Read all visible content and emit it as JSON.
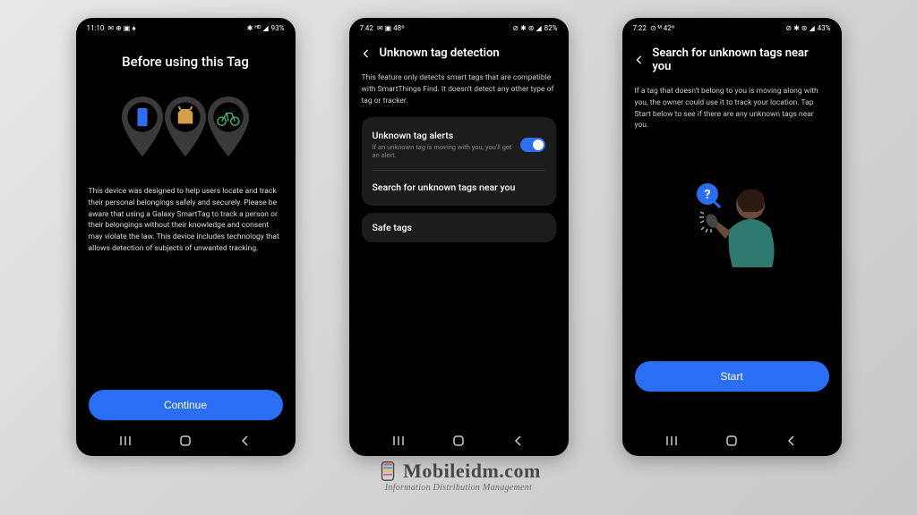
{
  "phones": [
    {
      "status": {
        "time": "11:10",
        "icons_left": "✉ ⊕ ▣ ♠",
        "icons_right": "✱ ᴴᴰ ◢",
        "battery": "93%"
      },
      "title": "Before using this Tag",
      "body": "This device was designed to help users locate and track their personal belongings safely and securely. Please be aware that using a Galaxy SmartTag to track a person or their belongings without their knowledge and consent may violate the law. This device includes technology that allows detection of subjects of unwanted tracking.",
      "button": "Continue"
    },
    {
      "status": {
        "time": "7:42",
        "icons_left": "✉ ▣ 48º",
        "icons_right": "⊘ ✱ ⊛ ◢",
        "battery": "82%"
      },
      "title": "Unknown tag detection",
      "intro": "This feature only detects smart tags that are compatible with SmartThings Find. It doesn't detect any other type of tag or tracker.",
      "alerts_title": "Unknown tag alerts",
      "alerts_sub": "If an unknown tag is moving with you, you'll get an alert.",
      "search_row": "Search for unknown tags near you",
      "safe_tags": "Safe tags"
    },
    {
      "status": {
        "time": "7:22",
        "icons_left": "⊙ ᴹ 42º",
        "icons_right": "⊘ ✱ ⊛ ◢",
        "battery": "43%"
      },
      "title": "Search for unknown tags near you",
      "body": "If a tag that doesn't belong to you is moving along with you, the owner could use it to track your location. Tap Start below to see if there are any unknown tags near you.",
      "button": "Start"
    }
  ],
  "logo": {
    "brand": "Mobileidm.com",
    "tagline": "Information Distribution Management"
  }
}
